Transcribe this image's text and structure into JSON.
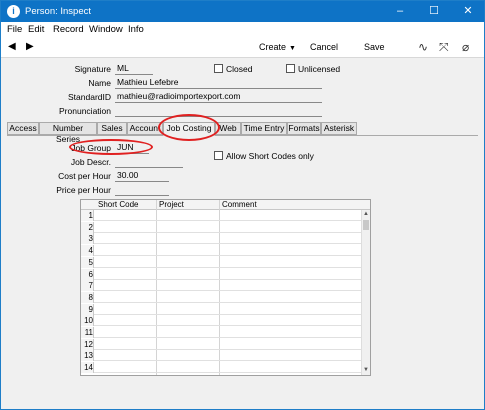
{
  "window": {
    "title": "Person: Inspect",
    "app_icon": "info-circle-icon",
    "minimize": "–",
    "maximize": "☐",
    "close": "✕"
  },
  "menu": [
    "File",
    "Edit",
    "Record",
    "Window",
    "Info"
  ],
  "toolbar": {
    "back": "◀",
    "forward": "▶",
    "create": "Create",
    "create_caret": "▼",
    "cancel": "Cancel",
    "save": "Save",
    "icons": [
      "activity-icon",
      "expand-icon",
      "paperclip-icon"
    ],
    "icon_glyphs": [
      "∿",
      "⤧",
      "⌀"
    ]
  },
  "header": {
    "signature_label": "Signature",
    "signature": "ML",
    "name_label": "Name",
    "name": "Mathieu Lefebre",
    "standardid_label": "StandardID",
    "standardid": "mathieu@radioimportexport.com",
    "pronunciation_label": "Pronunciation",
    "pronunciation": "",
    "closed_label": "Closed",
    "closed": false,
    "unlicensed_label": "Unlicensed",
    "unlicensed": false
  },
  "tabs": [
    "Access",
    "Number Series",
    "Sales",
    "Account",
    "Job Costing",
    "Web",
    "Time Entry",
    "Formats",
    "Asterisk"
  ],
  "active_tab": "Job Costing",
  "job_costing": {
    "job_group_label": "Job Group",
    "job_group": "JUN",
    "job_descr_label": "Job Descr.",
    "job_descr": "",
    "cost_per_hour_label": "Cost per Hour",
    "cost_per_hour": "30.00",
    "price_per_hour_label": "Price per Hour",
    "price_per_hour": "",
    "allow_short_codes_label": "Allow Short Codes only",
    "allow_short_codes": false
  },
  "grid": {
    "columns": [
      "Short Code",
      "Project",
      "Comment"
    ],
    "rows": [
      "1",
      "2",
      "3",
      "4",
      "5",
      "6",
      "7",
      "8",
      "9",
      "10",
      "11",
      "12",
      "13",
      "14"
    ],
    "scroll_up": "▲",
    "scroll_down": "▼"
  },
  "colors": {
    "titlebar": "#0e73c6",
    "highlight_circle": "#e02020"
  }
}
